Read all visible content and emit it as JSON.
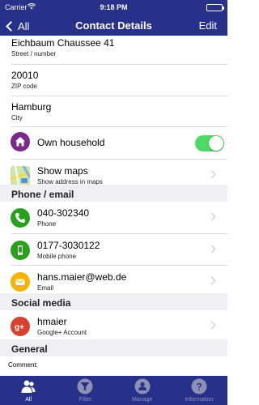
{
  "status": {
    "carrier": "Carrier",
    "time": "9:18 PM"
  },
  "nav": {
    "back_label": "All",
    "title": "Contact Details",
    "edit_label": "Edit"
  },
  "address": {
    "street": {
      "value": "Eichbaum Chaussee 41",
      "label": "Street / number"
    },
    "zip": {
      "value": "20010",
      "label": "ZIP code"
    },
    "city": {
      "value": "Hamburg",
      "label": "City"
    }
  },
  "household": {
    "label": "Own household",
    "icon": "house-icon",
    "toggle_on": true,
    "color": "#7a2a8c"
  },
  "maps": {
    "label": "Show maps",
    "sublabel": "Show address in maps",
    "icon": "map-icon"
  },
  "sections": {
    "phone_email": "Phone / email",
    "social": "Social media",
    "general": "General"
  },
  "contacts": [
    {
      "value": "040-302340",
      "label": "Phone",
      "icon": "phone-icon",
      "color": "#29a11d"
    },
    {
      "value": "0177-3030122",
      "label": "Mobile phone",
      "icon": "mobile-phone-icon",
      "color": "#29a11d"
    },
    {
      "value": "hans.maier@web.de",
      "label": "Email",
      "icon": "mail-icon",
      "color": "#f5b400"
    }
  ],
  "social": {
    "value": "hmaier",
    "label": "Google+ Account",
    "icon": "google-plus-icon",
    "color": "#d8412f"
  },
  "general": {
    "comment_label": "Comment:"
  },
  "tabs": [
    {
      "label": "All",
      "icon": "contacts-icon",
      "active": true
    },
    {
      "label": "Filter",
      "icon": "filter-icon",
      "active": false
    },
    {
      "label": "Manage",
      "icon": "manage-icon",
      "active": false
    },
    {
      "label": "Information",
      "icon": "info-icon",
      "active": false
    }
  ],
  "colors": {
    "bar": "#27318a",
    "toggle_on": "#4cd964",
    "section_bg": "#efeff4"
  }
}
